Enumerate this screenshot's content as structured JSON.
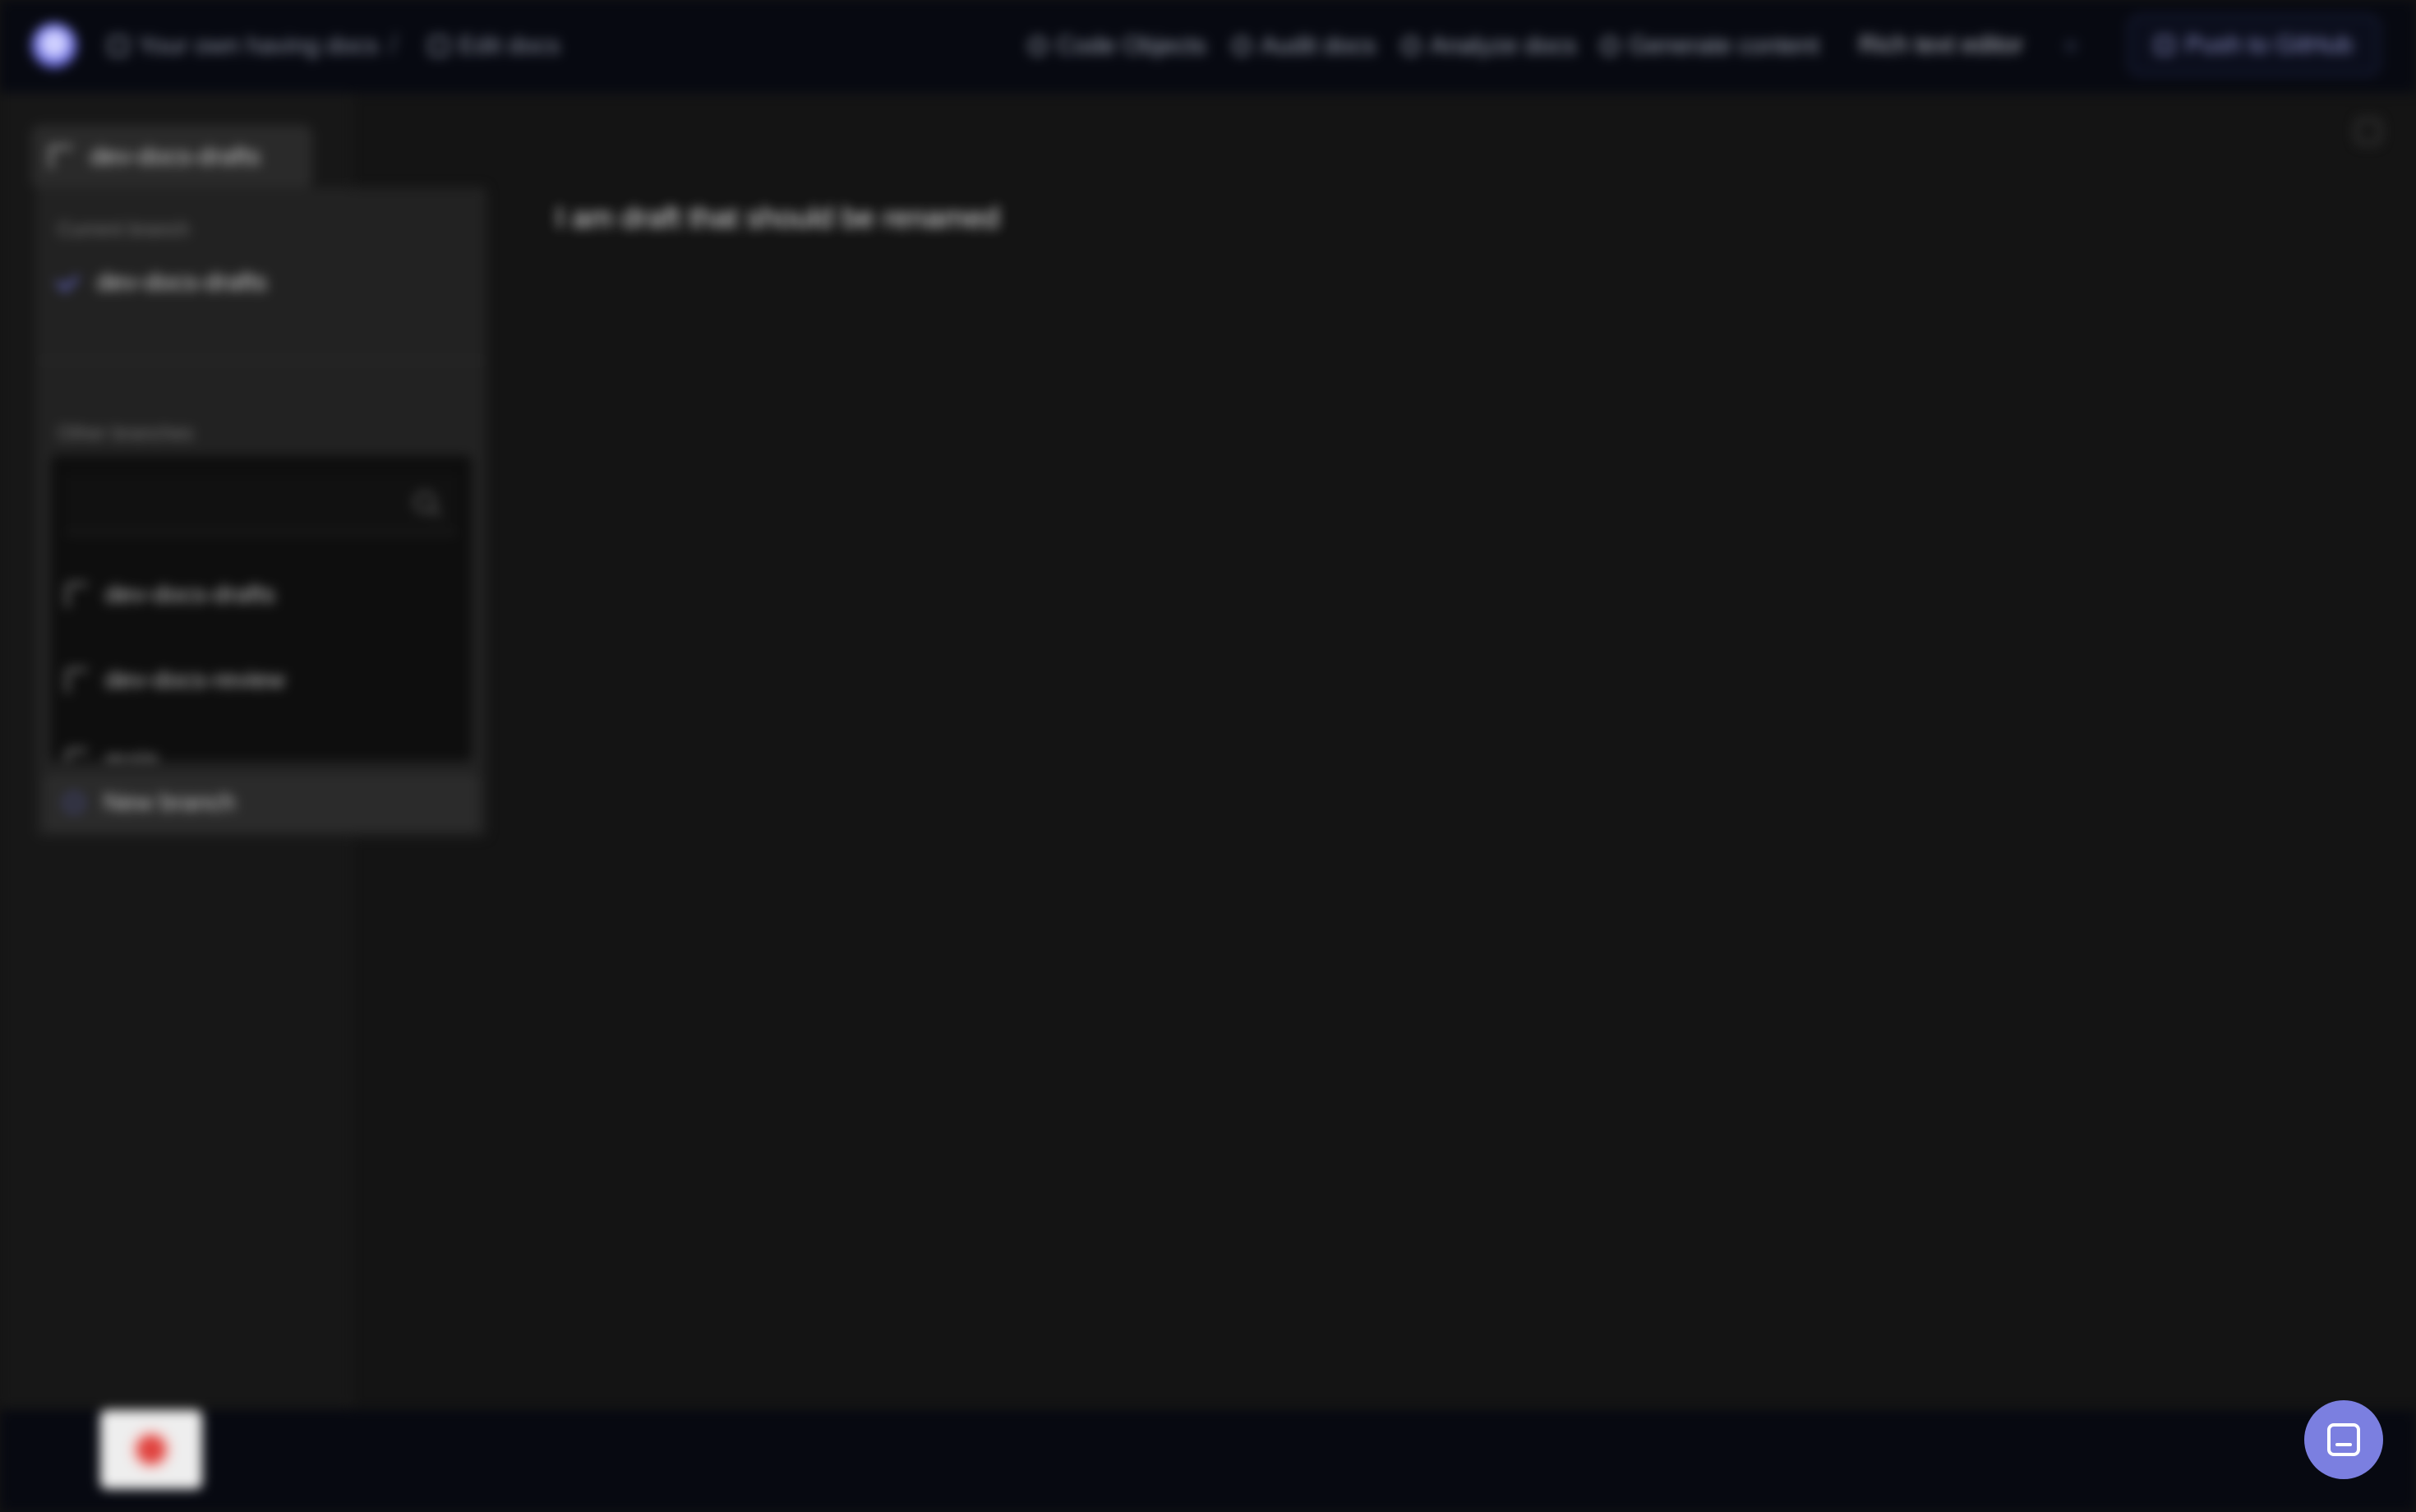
{
  "topbar": {
    "breadcrumb_project": "Your own having docs",
    "breadcrumb_separator": "/",
    "breadcrumb_page": "Edit docs",
    "nav": [
      {
        "label": "Code Objects"
      },
      {
        "label": "Audit docs"
      },
      {
        "label": "Analyze docs"
      },
      {
        "label": "Generate content"
      }
    ],
    "rich_text_editor": "Rich text editor",
    "push_button": "Push to GitHub"
  },
  "branch_trigger": {
    "label": "dev-docs-drafts"
  },
  "dropdown": {
    "current_label": "Current branch",
    "current_branch": "dev-docs-drafts",
    "other_label": "Other branches",
    "search_placeholder": "",
    "branches": [
      {
        "label": "dev-docs-drafts"
      },
      {
        "label": "dev-docs-review"
      },
      {
        "label": "main"
      }
    ],
    "new_branch": "New branch"
  },
  "main": {
    "content_text": "I am draft that should be renamed"
  },
  "colors": {
    "accent": "#6c6fd6",
    "record": "#e0433f",
    "chat": "#7b7fe0"
  },
  "icons": [
    "logo-icon",
    "file-icon",
    "circle-icon",
    "branch-icon",
    "check-icon",
    "search-icon",
    "plus-icon",
    "chat-icon",
    "record-icon"
  ]
}
